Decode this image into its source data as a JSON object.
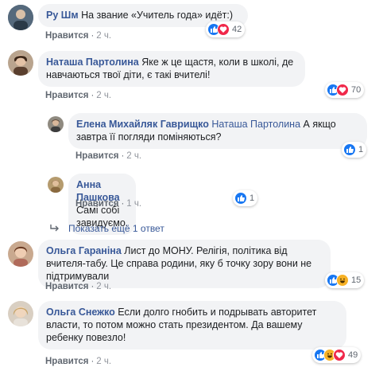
{
  "comments": [
    {
      "author": "Ру Шм",
      "text": "На звание «Учитель года» идёт:)",
      "like": "Нравится",
      "time": "2 ч.",
      "reactions": [
        "like",
        "love"
      ],
      "reaction_count": "42"
    },
    {
      "author": "Наташа Партолина",
      "text": "Яке ж це щастя, коли в школі, де навчаються твої діти, є такі вчителі!",
      "like": "Нравится",
      "time": "2 ч.",
      "reactions": [
        "like",
        "love"
      ],
      "reaction_count": "70"
    },
    {
      "author": "Елена Михайляк Гаврищко",
      "mention": "Наташа Партолина",
      "text": "А якщо завтра її погляди поміняються?",
      "like": "Нравится",
      "time": "2 ч.",
      "reactions": [
        "like"
      ],
      "reaction_count": "1"
    },
    {
      "author": "Анна Пашкова",
      "text": "Самі собі завидуємо.",
      "like": "Нравится",
      "time": "1 ч.",
      "reactions": [
        "like"
      ],
      "reaction_count": "1"
    },
    {
      "author": "Ольга Гаранiна",
      "text": "Лист до МОНУ. Релігія, політика від вчителя-табу. Це справа родини, яку б точку зору вони не підтримували",
      "like": "Нравится",
      "time": "2 ч.",
      "reactions": [
        "like",
        "haha"
      ],
      "reaction_count": "15"
    },
    {
      "author": "Ольга Снежко",
      "text": "Если долго гнобить и подрывать авторитет власти, то потом можно стать президентом. Да вашему ребенку повезло!",
      "like": "Нравится",
      "time": "2 ч.",
      "reactions": [
        "like",
        "haha",
        "love"
      ],
      "reaction_count": "49"
    }
  ],
  "more_replies": "Показать ещё 1 ответ",
  "separator": "·",
  "colors": {
    "link": "#385898",
    "bubble": "#f2f3f5",
    "like": "#1877f2",
    "love": "#f0284a",
    "haha": "#f7b125"
  }
}
